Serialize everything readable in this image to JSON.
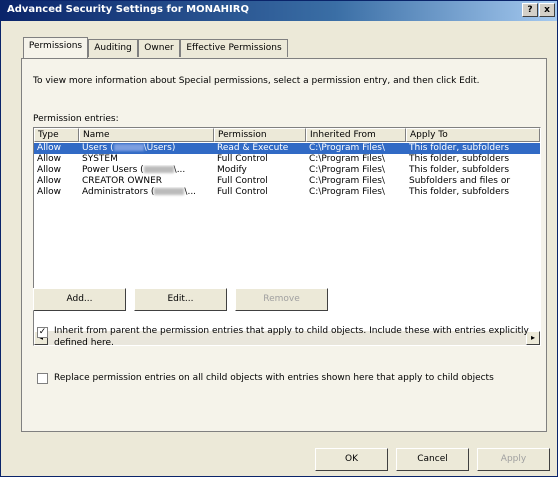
{
  "window": {
    "title": "Advanced Security Settings for MONAHIRQ",
    "help_label": "?",
    "close_label": "x"
  },
  "tabs": [
    {
      "label": "Permissions",
      "active": true
    },
    {
      "label": "Auditing",
      "active": false
    },
    {
      "label": "Owner",
      "active": false
    },
    {
      "label": "Effective Permissions",
      "active": false
    }
  ],
  "permissions": {
    "instruction": "To view more information about Special permissions, select a permission entry, and then click Edit.",
    "entries_label": "Permission entries:",
    "columns": [
      "Type",
      "Name",
      "Permission",
      "Inherited From",
      "Apply To"
    ],
    "rows": [
      {
        "type": "Allow",
        "name_prefix": "Users (",
        "name_suffix": "\\Users)",
        "permission": "Read & Execute",
        "inherited_from": "C:\\Program Files\\",
        "apply_to": "This folder, subfolders",
        "selected": true
      },
      {
        "type": "Allow",
        "name_prefix": "SYSTEM",
        "name_suffix": "",
        "permission": "Full Control",
        "inherited_from": "C:\\Program Files\\",
        "apply_to": "This folder, subfolders",
        "selected": false
      },
      {
        "type": "Allow",
        "name_prefix": "Power Users (",
        "name_suffix": "\\...",
        "permission": "Modify",
        "inherited_from": "C:\\Program Files\\",
        "apply_to": "This folder, subfolders",
        "selected": false
      },
      {
        "type": "Allow",
        "name_prefix": "CREATOR OWNER",
        "name_suffix": "",
        "permission": "Full Control",
        "inherited_from": "C:\\Program Files\\",
        "apply_to": "Subfolders and files or",
        "selected": false
      },
      {
        "type": "Allow",
        "name_prefix": "Administrators (",
        "name_suffix": "\\...",
        "permission": "Full Control",
        "inherited_from": "C:\\Program Files\\",
        "apply_to": "This folder, subfolders",
        "selected": false
      }
    ],
    "scroll_left": "◂",
    "scroll_right": "▸",
    "buttons": {
      "add": "Add...",
      "edit": "Edit...",
      "remove": "Remove"
    },
    "inherit_checkbox": {
      "checked": true,
      "mark": "✓",
      "line1": "Inherit from parent the permission entries that apply to child objects. Include these with entries explicitly",
      "line2": "defined here."
    },
    "replace_checkbox": {
      "checked": false,
      "label": "Replace permission entries on all child objects with entries shown here that apply to child objects"
    }
  },
  "footer": {
    "ok": "OK",
    "cancel": "Cancel",
    "apply": "Apply"
  }
}
